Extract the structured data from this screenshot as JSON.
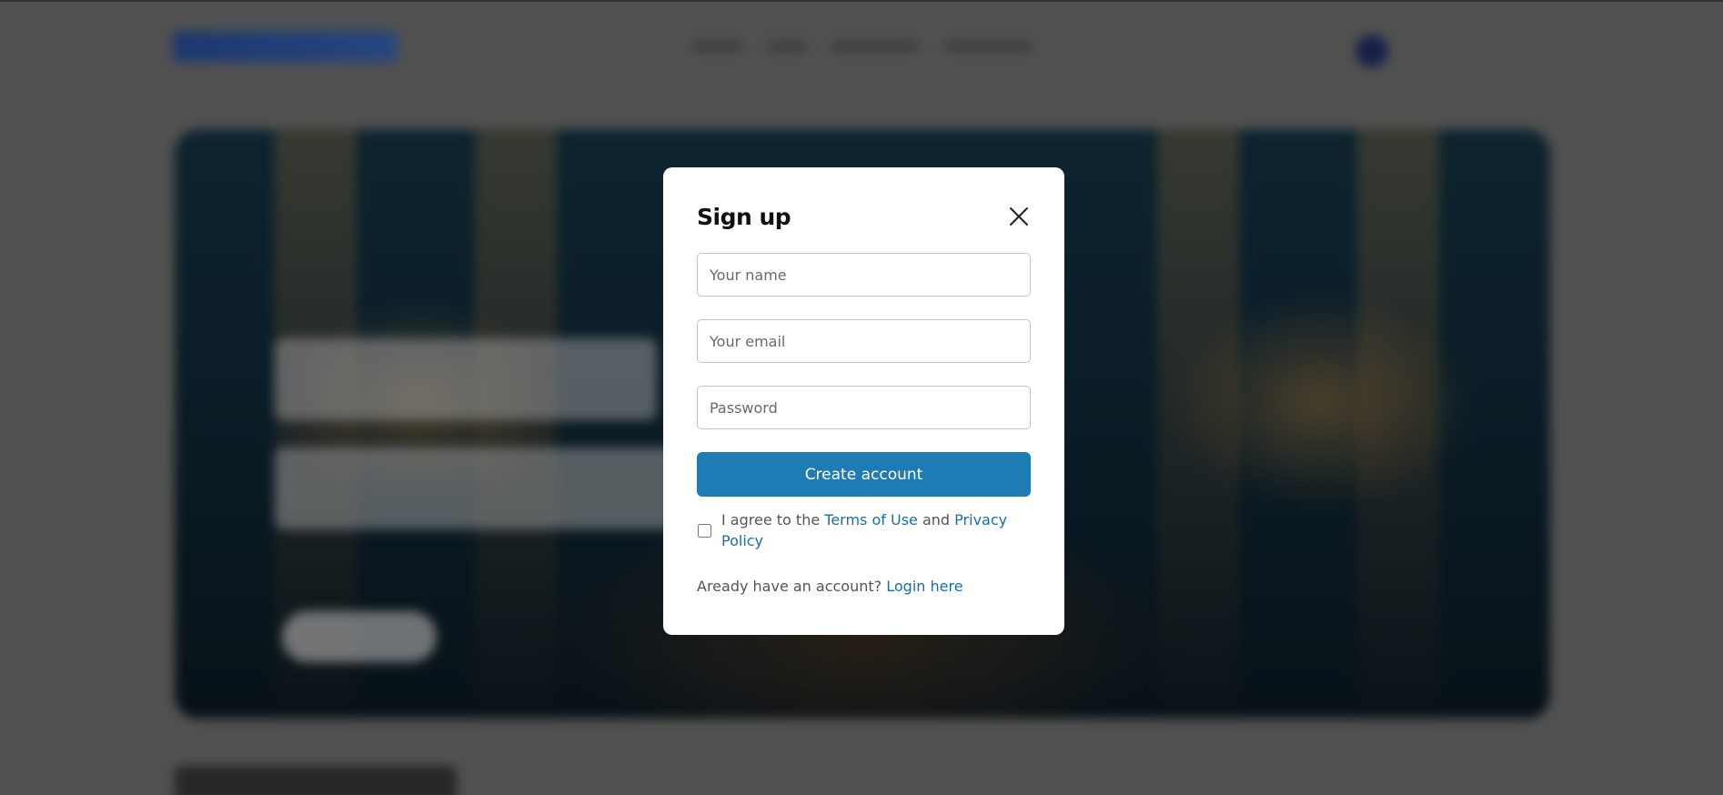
{
  "modal": {
    "title": "Sign up",
    "close_icon": "close-icon",
    "name_placeholder": "Your name",
    "email_placeholder": "Your email",
    "password_placeholder": "Password",
    "submit_label": "Create account",
    "terms": {
      "prefix": "I agree to the",
      "terms_link": "Terms of Use",
      "conjunction": "and",
      "privacy_link": "Privacy Policy",
      "checked": false
    },
    "login_prompt": "Aready have an account?",
    "login_link": "Login here"
  },
  "colors": {
    "primary": "#1f7bb3",
    "link": "#1a6fa3",
    "overlay": "rgba(0,0,0,0.35)"
  }
}
